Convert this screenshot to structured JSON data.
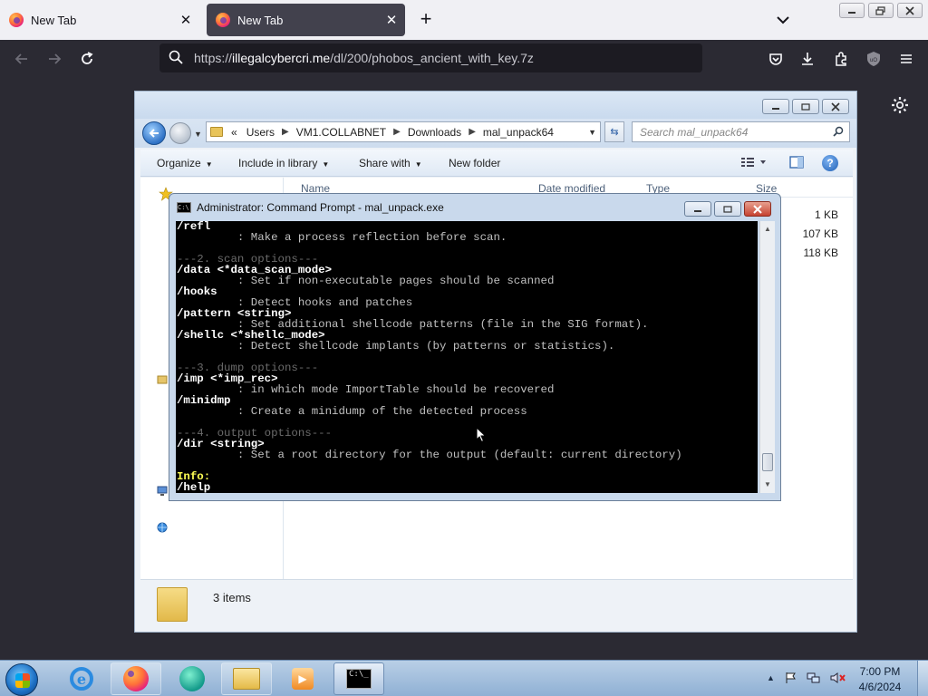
{
  "browser": {
    "tabs": [
      {
        "label": "New Tab",
        "close": "✕",
        "active": false
      },
      {
        "label": "New Tab",
        "close": "✕",
        "active": true
      }
    ],
    "new_tab": "+",
    "url_prefix": "https://",
    "url_host": "illegalcybercri.me",
    "url_path": "/dl/200/phobos_ancient_with_key.7z"
  },
  "explorer": {
    "breadcrumbs": [
      "«",
      "Users",
      "VM1.COLLABNET",
      "Downloads",
      "mal_unpack64"
    ],
    "search_placeholder": "Search mal_unpack64",
    "toolbar": {
      "organize": "Organize",
      "include": "Include in library",
      "share": "Share with",
      "new_folder": "New folder"
    },
    "columns": [
      "Name",
      "Date modified",
      "Type",
      "Size"
    ],
    "sizes": [
      "1 KB",
      "107 KB",
      "118 KB"
    ],
    "status": "3 items"
  },
  "cmd": {
    "title": "Administrator:  Command Prompt - mal_unpack.exe",
    "lines": [
      {
        "text": "/refl",
        "style": "bright"
      },
      {
        "text": "         : Make a process reflection before scan.",
        "style": "normal"
      },
      {
        "text": "",
        "style": "normal"
      },
      {
        "text": "---2. scan options---",
        "style": "sect"
      },
      {
        "text": "/data <*data_scan_mode>",
        "style": "bright"
      },
      {
        "text": "         : Set if non-executable pages should be scanned",
        "style": "normal"
      },
      {
        "text": "/hooks",
        "style": "bright"
      },
      {
        "text": "         : Detect hooks and patches",
        "style": "normal"
      },
      {
        "text": "/pattern <string>",
        "style": "bright"
      },
      {
        "text": "         : Set additional shellcode patterns (file in the SIG format).",
        "style": "normal"
      },
      {
        "text": "/shellc <*shellc_mode>",
        "style": "bright"
      },
      {
        "text": "         : Detect shellcode implants (by patterns or statistics).",
        "style": "normal"
      },
      {
        "text": "",
        "style": "normal"
      },
      {
        "text": "---3. dump options---",
        "style": "sect"
      },
      {
        "text": "/imp <*imp_rec>",
        "style": "bright"
      },
      {
        "text": "         : in which mode ImportTable should be recovered",
        "style": "normal"
      },
      {
        "text": "/minidmp",
        "style": "bright"
      },
      {
        "text": "         : Create a minidump of the detected process",
        "style": "normal"
      },
      {
        "text": "",
        "style": "normal"
      },
      {
        "text": "---4. output options---",
        "style": "sect"
      },
      {
        "text": "/dir <string>",
        "style": "bright"
      },
      {
        "text": "         : Set a root directory for the output (default: current directory)",
        "style": "normal"
      },
      {
        "text": "",
        "style": "normal"
      },
      {
        "text": "Info:",
        "style": "info"
      },
      {
        "text": "/help",
        "style": "bright"
      }
    ]
  },
  "taskbar": {
    "time": "7:00 PM",
    "date": "4/6/2024"
  },
  "colors": {
    "browser_bg": "#2b2a33",
    "console_bg": "#000000",
    "console_text": "#c0c0c0",
    "console_info": "#ffff55"
  }
}
